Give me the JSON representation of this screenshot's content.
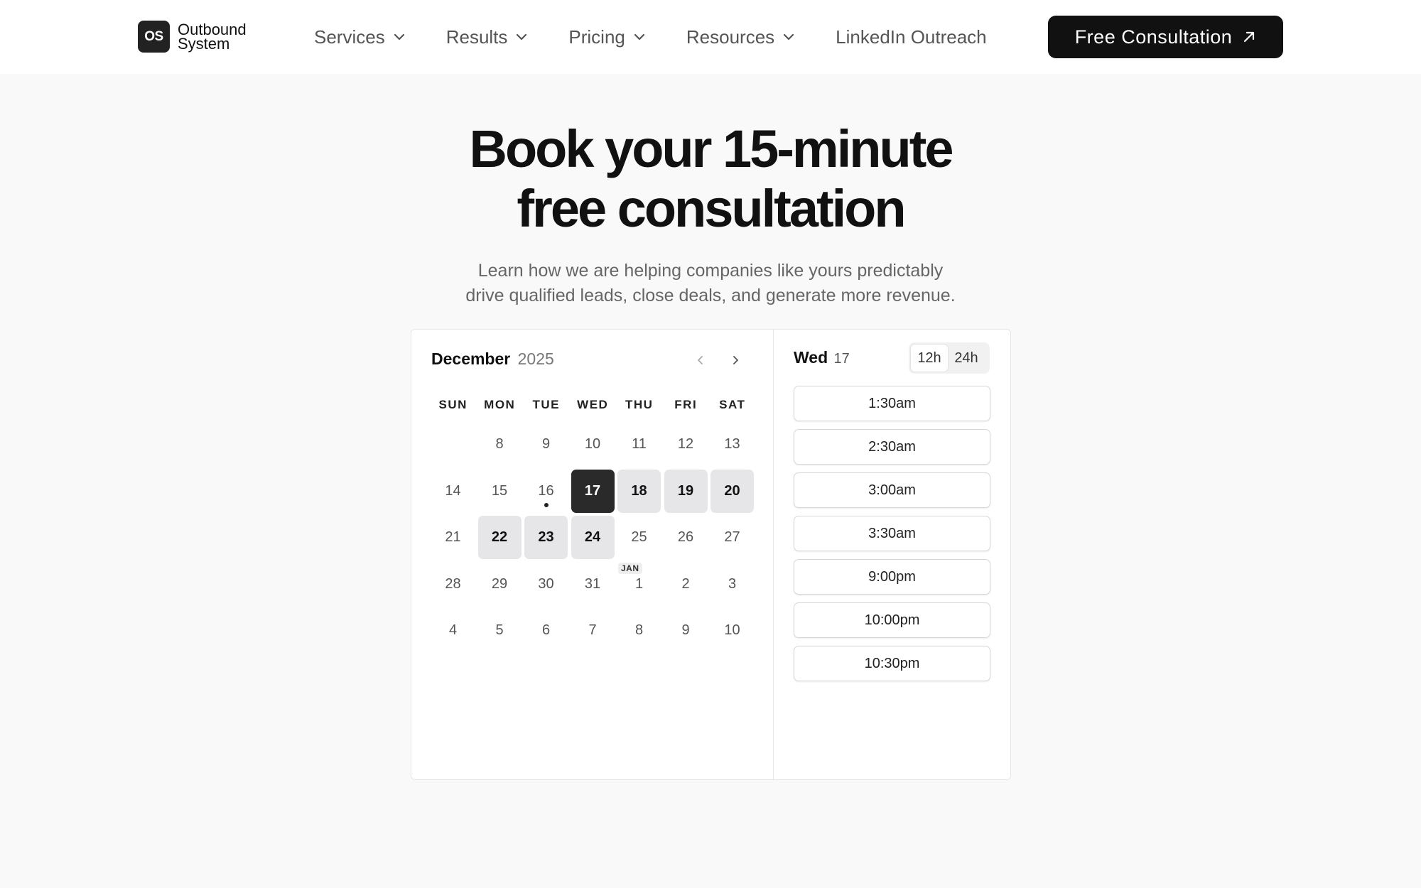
{
  "header": {
    "logo": {
      "mark": "OS",
      "line1": "Outbound",
      "line2": "System"
    },
    "nav": [
      {
        "label": "Services",
        "dropdown": true
      },
      {
        "label": "Results",
        "dropdown": true
      },
      {
        "label": "Pricing",
        "dropdown": true
      },
      {
        "label": "Resources",
        "dropdown": true
      },
      {
        "label": "LinkedIn Outreach",
        "dropdown": false
      }
    ],
    "cta_label": "Free Consultation"
  },
  "hero": {
    "title_line1": "Book your 15-minute",
    "title_line2": "free consultation",
    "subtitle_line1": "Learn how we are helping companies like yours predictably",
    "subtitle_line2": "drive qualified leads, close deals, and generate more revenue."
  },
  "calendar": {
    "month": "December",
    "year": "2025",
    "weekdays": [
      "SUN",
      "MON",
      "TUE",
      "WED",
      "THU",
      "FRI",
      "SAT"
    ],
    "weeks": [
      [
        null,
        {
          "d": "8"
        },
        {
          "d": "9"
        },
        {
          "d": "10"
        },
        {
          "d": "11"
        },
        {
          "d": "12"
        },
        {
          "d": "13"
        }
      ],
      [
        {
          "d": "14"
        },
        {
          "d": "15"
        },
        {
          "d": "16",
          "today": true
        },
        {
          "d": "17",
          "state": "selected"
        },
        {
          "d": "18",
          "state": "available"
        },
        {
          "d": "19",
          "state": "available"
        },
        {
          "d": "20",
          "state": "available"
        }
      ],
      [
        {
          "d": "21"
        },
        {
          "d": "22",
          "state": "available"
        },
        {
          "d": "23",
          "state": "available"
        },
        {
          "d": "24",
          "state": "available"
        },
        {
          "d": "25"
        },
        {
          "d": "26"
        },
        {
          "d": "27"
        }
      ],
      [
        {
          "d": "28"
        },
        {
          "d": "29"
        },
        {
          "d": "30"
        },
        {
          "d": "31"
        },
        {
          "d": "1",
          "badge": "JAN"
        },
        {
          "d": "2"
        },
        {
          "d": "3"
        }
      ],
      [
        {
          "d": "4"
        },
        {
          "d": "5"
        },
        {
          "d": "6"
        },
        {
          "d": "7"
        },
        {
          "d": "8"
        },
        {
          "d": "9"
        },
        {
          "d": "10"
        }
      ]
    ]
  },
  "times": {
    "day_name": "Wed",
    "day_num": "17",
    "format_options": [
      "12h",
      "24h"
    ],
    "format_selected": "12h",
    "slots": [
      "1:30am",
      "2:30am",
      "3:00am",
      "3:30am",
      "9:00pm",
      "10:00pm",
      "10:30pm"
    ]
  }
}
